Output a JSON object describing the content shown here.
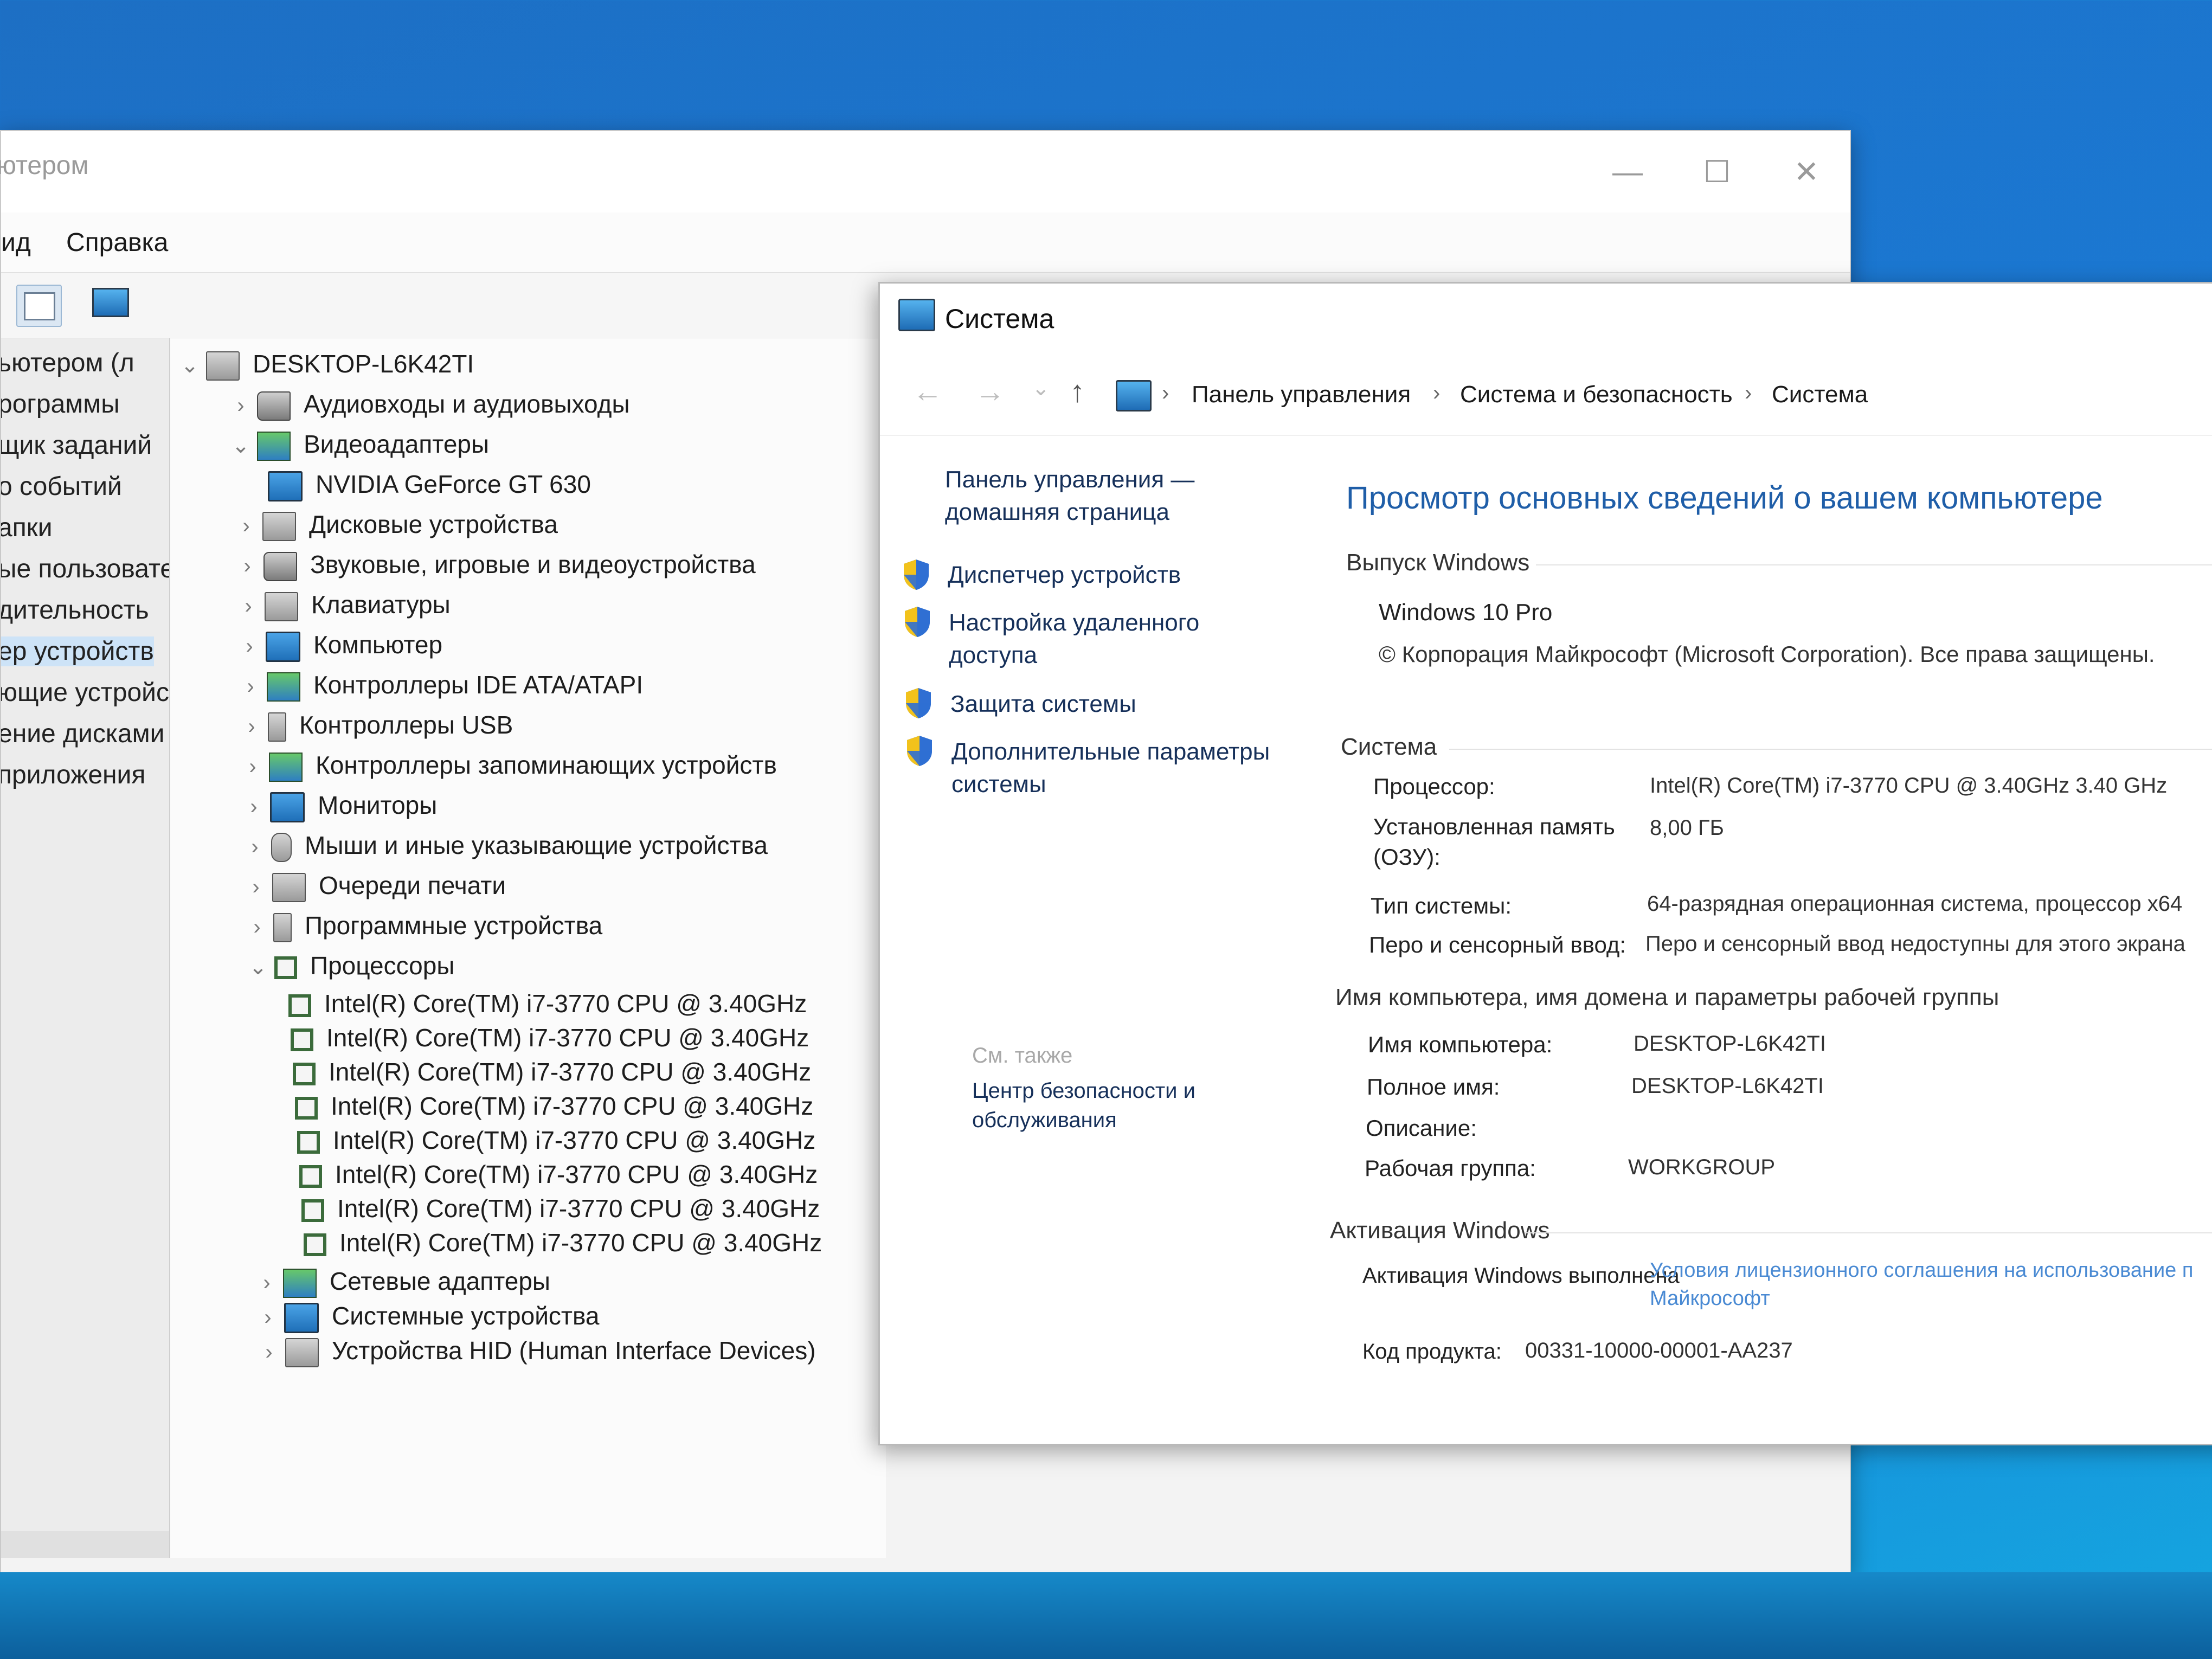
{
  "device_manager": {
    "title": "ютером",
    "caption_buttons": {
      "minimize": "—",
      "maximize": "☐",
      "close": "✕"
    },
    "menu": [
      "ид",
      "Справка"
    ],
    "left_pane_items": [
      "ьютером (л",
      "рограммы",
      "щик заданий",
      "о событий",
      "апки",
      "ые пользовате",
      "дительность",
      "ер устройств",
      "ющие устройст",
      "ение дисками",
      "приложения"
    ],
    "tree": {
      "root": "DESKTOP-L6K42TI",
      "categories": [
        "Аудиовходы и аудиовыходы",
        "Видеоадаптеры",
        "NVIDIA GeForce GT 630",
        "Дисковые устройства",
        "Звуковые, игровые и видеоустройства",
        "Клавиатуры",
        "Компьютер",
        "Контроллеры IDE ATA/ATAPI",
        "Контроллеры USB",
        "Контроллеры запоминающих устройств",
        "Мониторы",
        "Мыши и иные указывающие устройства",
        "Очереди печати",
        "Программные устройства",
        "Процессоры",
        "Сетевые адаптеры",
        "Системные устройства",
        "Устройства HID (Human Interface Devices)"
      ],
      "processors": [
        "Intel(R) Core(TM) i7-3770 CPU @ 3.40GHz",
        "Intel(R) Core(TM) i7-3770 CPU @ 3.40GHz",
        "Intel(R) Core(TM) i7-3770 CPU @ 3.40GHz",
        "Intel(R) Core(TM) i7-3770 CPU @ 3.40GHz",
        "Intel(R) Core(TM) i7-3770 CPU @ 3.40GHz",
        "Intel(R) Core(TM) i7-3770 CPU @ 3.40GHz",
        "Intel(R) Core(TM) i7-3770 CPU @ 3.40GHz",
        "Intel(R) Core(TM) i7-3770 CPU @ 3.40GHz"
      ]
    }
  },
  "system_window": {
    "title": "Система",
    "breadcrumb": [
      "Панель управления",
      "Система и безопасность",
      "Система"
    ],
    "nav": {
      "back": "←",
      "forward": "→",
      "dropdown": "⌄",
      "up": "↑",
      "sep": "›"
    },
    "sidebar": {
      "home_link": [
        "Панель управления —",
        "домашняя страница"
      ],
      "links": [
        [
          "Диспетчер устройств"
        ],
        [
          "Настройка удаленного",
          "доступа"
        ],
        [
          "Защита системы"
        ],
        [
          "Дополнительные параметры",
          "системы"
        ]
      ],
      "see_also_label": "См. также",
      "see_also_link": [
        "Центр безопасности и",
        "обслуживания"
      ]
    },
    "main": {
      "heading": "Просмотр основных сведений о вашем компьютере",
      "windows_edition": {
        "section": "Выпуск Windows",
        "edition": "Windows 10 Pro",
        "copyright": "© Корпорация Майкрософт (Microsoft Corporation). Все права защищены."
      },
      "system": {
        "section": "Система",
        "processor_label": "Процессор:",
        "processor_value": "Intel(R) Core(TM) i7-3770 CPU @ 3.40GHz   3.40 GHz",
        "memory_label": [
          "Установленная память",
          "(ОЗУ):"
        ],
        "memory_value": "8,00 ГБ",
        "type_label": "Тип системы:",
        "type_value": "64-разрядная операционная система, процессор x64",
        "pen_label": "Перо и сенсорный ввод:",
        "pen_value": "Перо и сенсорный ввод недоступны для этого экрана"
      },
      "computer_name": {
        "section": "Имя компьютера, имя домена и параметры рабочей группы",
        "name_label": "Имя компьютера:",
        "name_value": "DESKTOP-L6K42TI",
        "full_label": "Полное имя:",
        "full_value": "DESKTOP-L6K42TI",
        "desc_label": "Описание:",
        "workgroup_label": "Рабочая группа:",
        "workgroup_value": "WORKGROUP"
      },
      "activation": {
        "section": "Активация Windows",
        "status": "Активация Windows выполнена",
        "license_link": [
          "Условия лицензионного соглашения на использование п",
          "Майкрософт"
        ],
        "product_label": "Код продукта:",
        "product_value": "00331-10000-00001-AA237"
      }
    }
  }
}
